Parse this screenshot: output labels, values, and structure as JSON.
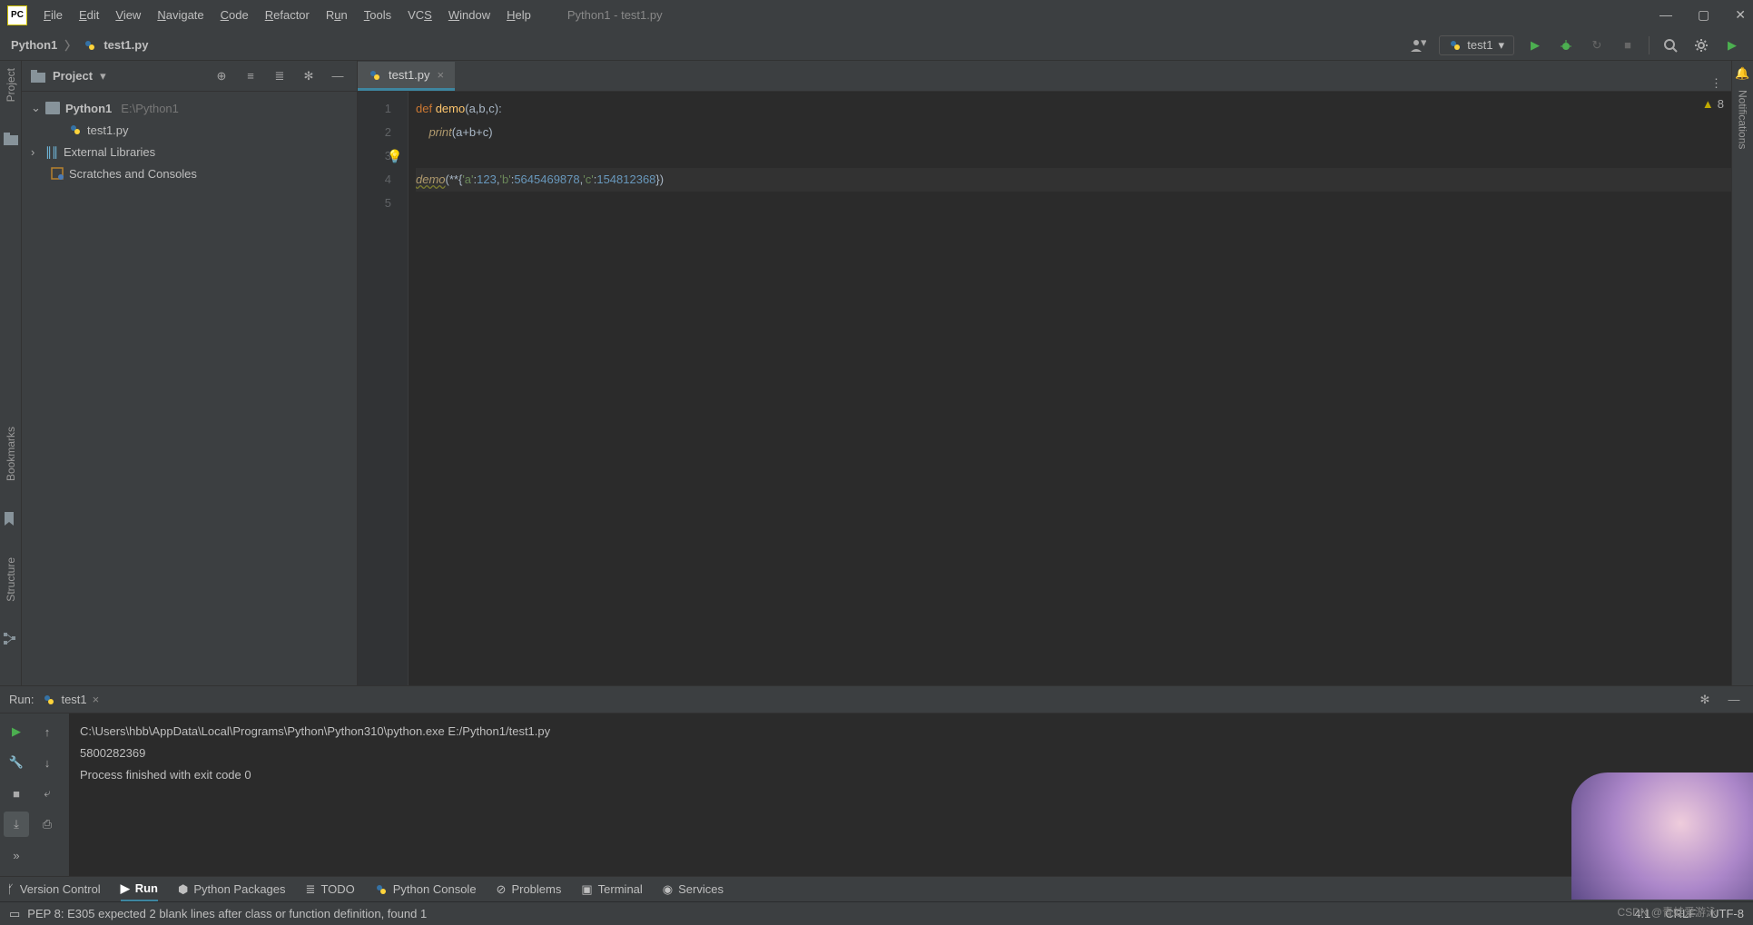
{
  "window": {
    "title": "Python1 - test1.py"
  },
  "menus": [
    "File",
    "Edit",
    "View",
    "Navigate",
    "Code",
    "Refactor",
    "Run",
    "Tools",
    "VCS",
    "Window",
    "Help"
  ],
  "breadcrumb": {
    "project": "Python1",
    "file": "test1.py"
  },
  "run_config": {
    "label": "test1"
  },
  "project_panel": {
    "title": "Project",
    "root": {
      "name": "Python1",
      "path": "E:\\Python1"
    },
    "file1": "test1.py",
    "ext_libs": "External Libraries",
    "scratches": "Scratches and Consoles"
  },
  "editor": {
    "tab_label": "test1.py",
    "gutter": [
      "1",
      "2",
      "3",
      "4",
      "5"
    ],
    "inspection_count": "8",
    "code": {
      "def_kw": "def ",
      "fn_name": "demo",
      "params_open": "(",
      "p1": "a",
      "c1": ",",
      "p2": "b",
      "c2": ",",
      "p3": "c",
      "params_close": "):",
      "indent2": "    ",
      "print_kw": "print",
      "print_arg_open": "(",
      "print_arg": "a+b+c",
      "print_arg_close": ")",
      "call_name": "demo",
      "call_args_prefix": "(**{",
      "key1": "'a'",
      "colon1": ":",
      "val1": "123",
      "sep1": ",",
      "key2": "'b'",
      "colon2": ":",
      "val2": "5645469878",
      "sep2": ",",
      "key3": "'c'",
      "colon3": ":",
      "val3": "154812368",
      "call_args_suffix": "})"
    }
  },
  "left_tabs": {
    "project": "Project",
    "bookmarks": "Bookmarks",
    "structure": "Structure"
  },
  "right_tabs": {
    "notifications": "Notifications"
  },
  "run_panel": {
    "label": "Run:",
    "tab": "test1",
    "line1": "C:\\Users\\hbb\\AppData\\Local\\Programs\\Python\\Python310\\python.exe E:/Python1/test1.py",
    "line2": "5800282369",
    "line3": "",
    "line4": "Process finished with exit code 0"
  },
  "bottom_tabs": {
    "vc": "Version Control",
    "run": "Run",
    "pkg": "Python Packages",
    "todo": "TODO",
    "console": "Python Console",
    "problems": "Problems",
    "terminal": "Terminal",
    "services": "Services"
  },
  "status": {
    "message": "PEP 8: E305 expected 2 blank lines after class or function definition, found 1",
    "pos": "4:1",
    "eol": "CRLF",
    "enc": "UTF-8"
  },
  "watermark": "CSDN @青蛙爱游泳"
}
